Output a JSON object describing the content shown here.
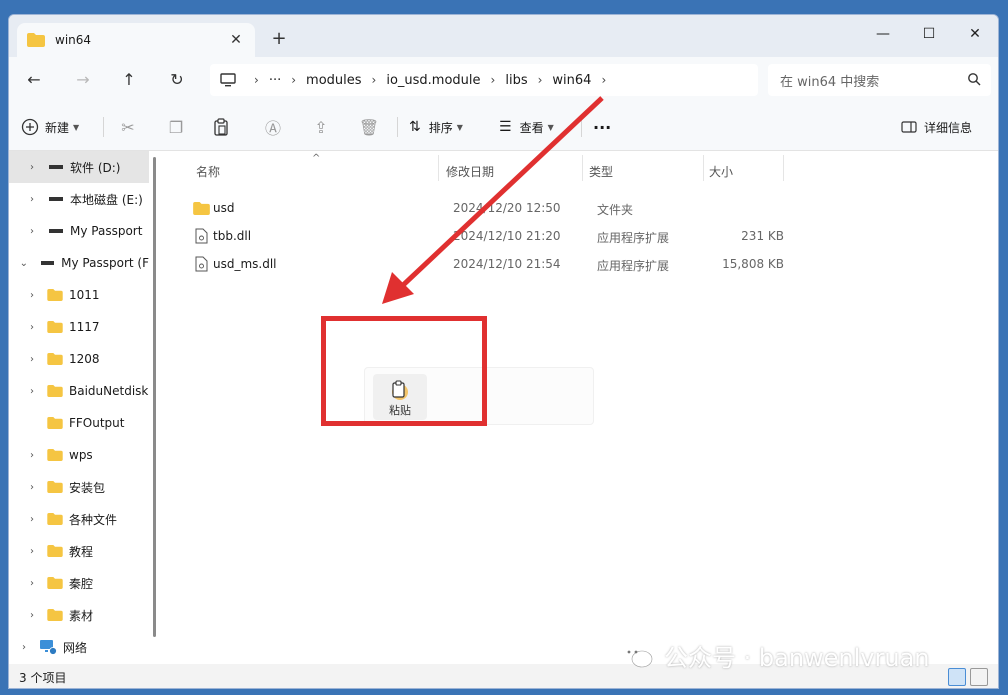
{
  "tab": {
    "title": "win64",
    "close": "✕",
    "new_tab": "+"
  },
  "window_controls": {
    "minimize": "—",
    "maximize": "☐",
    "close": "✕"
  },
  "nav": {
    "back": "←",
    "forward": "→",
    "up": "↑",
    "refresh": "↻"
  },
  "address": {
    "crumbs": [
      "···",
      "modules",
      "io_usd.module",
      "libs",
      "win64"
    ]
  },
  "search": {
    "placeholder": "在 win64 中搜索"
  },
  "toolbar": {
    "new_label": "新建",
    "sort_label": "排序",
    "view_label": "查看",
    "more_label": "···",
    "details_label": "详细信息"
  },
  "sidebar": {
    "items": [
      {
        "label": "软件 (D:)",
        "type": "drive"
      },
      {
        "label": "本地磁盘 (E:)",
        "type": "drive"
      },
      {
        "label": "My Passport",
        "type": "drive"
      },
      {
        "label": "My Passport (F",
        "type": "drive"
      },
      {
        "label": "1011",
        "type": "folder"
      },
      {
        "label": "1117",
        "type": "folder"
      },
      {
        "label": "1208",
        "type": "folder"
      },
      {
        "label": "BaiduNetdisk",
        "type": "folder"
      },
      {
        "label": "FFOutput",
        "type": "folder"
      },
      {
        "label": "wps",
        "type": "folder"
      },
      {
        "label": "安装包",
        "type": "folder"
      },
      {
        "label": "各种文件",
        "type": "folder"
      },
      {
        "label": "教程",
        "type": "folder"
      },
      {
        "label": "秦腔",
        "type": "folder"
      },
      {
        "label": "素材",
        "type": "folder"
      },
      {
        "label": "网络",
        "type": "network"
      }
    ]
  },
  "columns": {
    "name": "名称",
    "date": "修改日期",
    "type": "类型",
    "size": "大小"
  },
  "files": [
    {
      "name": "usd",
      "date": "2024/12/20 12:50",
      "type": "文件夹",
      "size": "",
      "kind": "folder"
    },
    {
      "name": "tbb.dll",
      "date": "2024/12/10 21:20",
      "type": "应用程序扩展",
      "size": "231 KB",
      "kind": "dll"
    },
    {
      "name": "usd_ms.dll",
      "date": "2024/12/10 21:54",
      "type": "应用程序扩展",
      "size": "15,808 KB",
      "kind": "dll"
    }
  ],
  "context_menu": {
    "paste_label": "粘贴"
  },
  "status": {
    "item_count": "3 个项目"
  },
  "watermark": {
    "text": "公众号 · banwenlvruan"
  },
  "colors": {
    "highlight_red": "#e03030",
    "folder_yellow": "#f5c542",
    "accent_blue": "#0067c0"
  }
}
